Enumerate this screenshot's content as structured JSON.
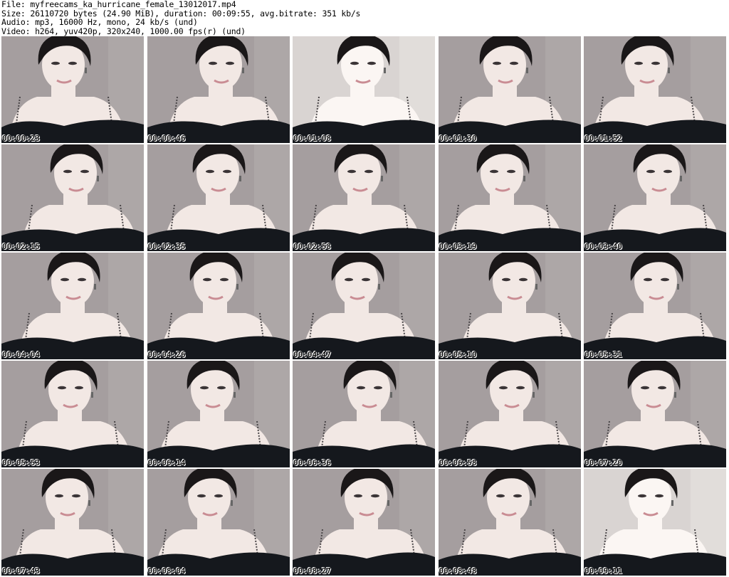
{
  "header": {
    "file_line": "File: myfreecams_ka_hurricane_female_13012017.mp4",
    "size_line": "Size: 26110720 bytes (24.90 MiB), duration: 00:09:55, avg.bitrate: 351 kb/s",
    "audio_line": "Audio: mp3, 16000 Hz, mono, 24 kb/s (und)",
    "video_line": "Video: h264, yuv420p, 320x240, 1000.00 fps(r) (und)"
  },
  "thumbnails": [
    {
      "timestamp": "00:00:23"
    },
    {
      "timestamp": "00:00:46"
    },
    {
      "timestamp": "00:01:08"
    },
    {
      "timestamp": "00:01:30"
    },
    {
      "timestamp": "00:01:52"
    },
    {
      "timestamp": "00:02:15"
    },
    {
      "timestamp": "00:02:35"
    },
    {
      "timestamp": "00:02:58"
    },
    {
      "timestamp": "00:03:19"
    },
    {
      "timestamp": "00:03:40"
    },
    {
      "timestamp": "00:04:04"
    },
    {
      "timestamp": "00:04:26"
    },
    {
      "timestamp": "00:04:47"
    },
    {
      "timestamp": "00:05:10"
    },
    {
      "timestamp": "00:05:31"
    },
    {
      "timestamp": "00:05:53"
    },
    {
      "timestamp": "00:06:14"
    },
    {
      "timestamp": "00:06:36"
    },
    {
      "timestamp": "00:06:58"
    },
    {
      "timestamp": "00:07:20"
    },
    {
      "timestamp": "00:07:43"
    },
    {
      "timestamp": "00:08:04"
    },
    {
      "timestamp": "00:08:27"
    },
    {
      "timestamp": "00:08:48"
    },
    {
      "timestamp": "00:09:11"
    }
  ]
}
